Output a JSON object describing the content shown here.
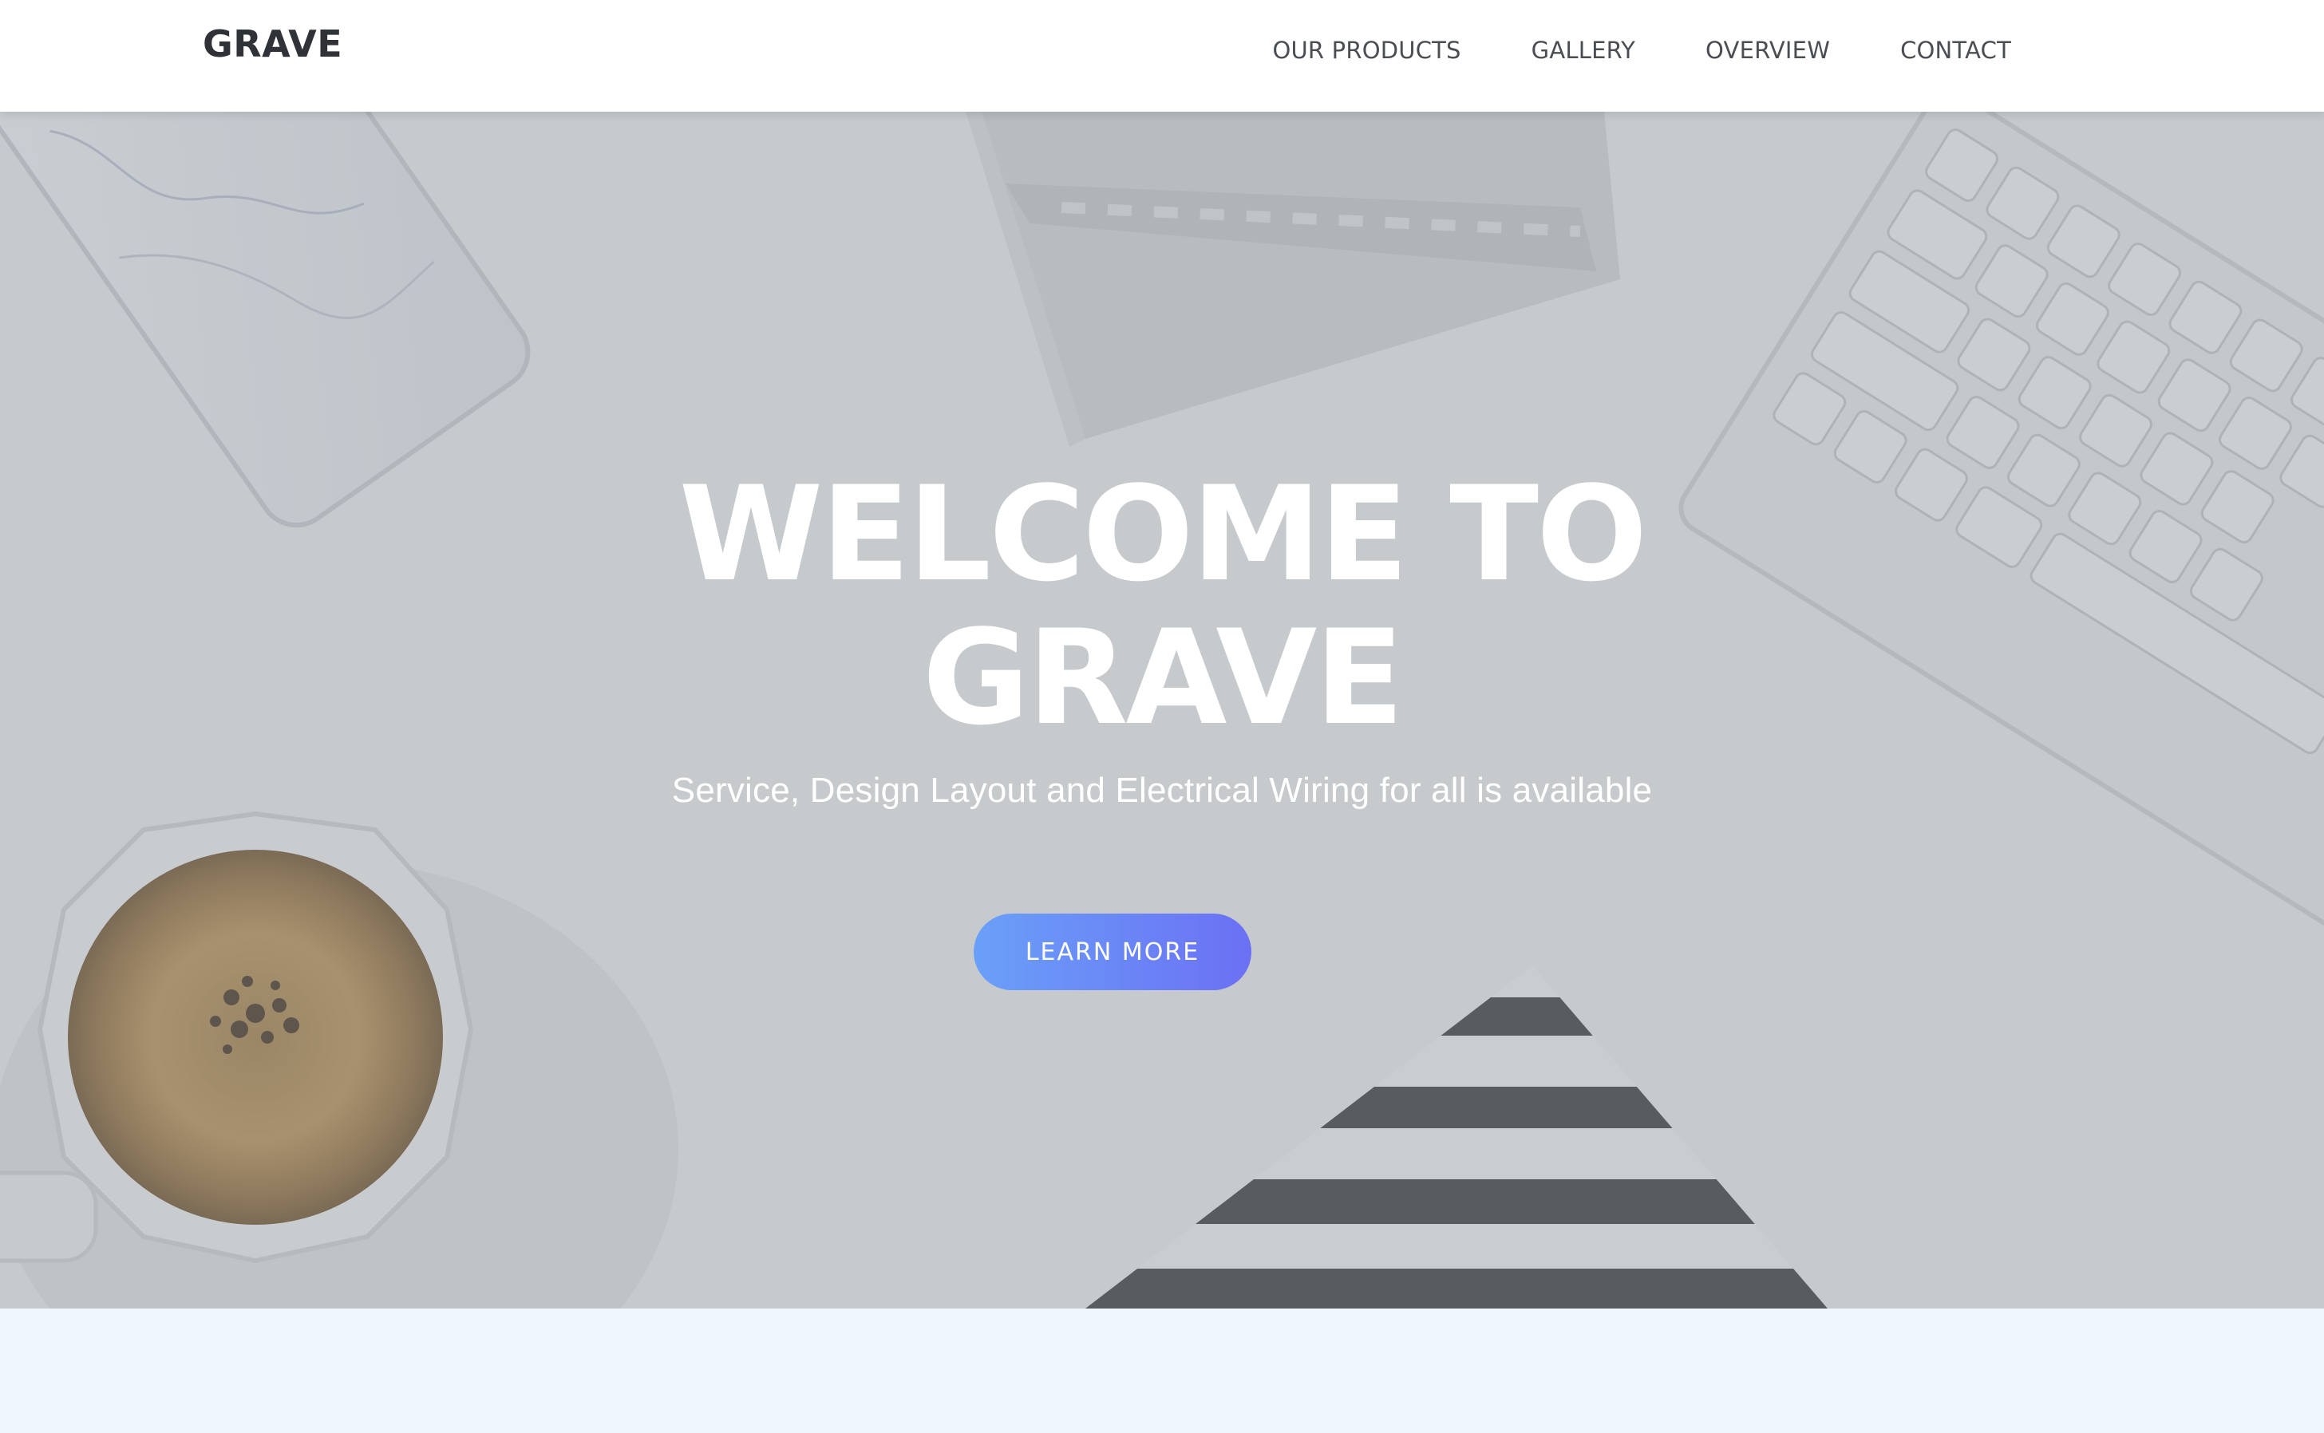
{
  "navbar": {
    "brand": "GRAVE",
    "links": [
      "OUR PRODUCTS",
      "GALLERY",
      "OVERVIEW",
      "CONTACT"
    ]
  },
  "hero": {
    "title_line_1": "WELCOME TO",
    "title_line_2": "GRAVE",
    "subtitle": "Service, Design Layout and Electrical Wiring for all is available",
    "button_label": "LEARN MORE"
  },
  "colors": {
    "navbar_bg": "#ffffff",
    "brand_text": "#2f3236",
    "hero_overlay": "#91989e",
    "button_gradient_start": "#6aa0f8",
    "button_gradient_end": "#6b70f4",
    "section_bg": "#eff6fd"
  }
}
